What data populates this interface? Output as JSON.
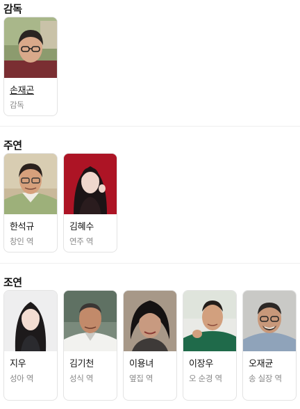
{
  "sections": {
    "director": {
      "title": "감독",
      "people": [
        {
          "name": "손재곤",
          "role": "감독"
        }
      ]
    },
    "lead": {
      "title": "주연",
      "people": [
        {
          "name": "한석규",
          "role": "창인 역"
        },
        {
          "name": "김혜수",
          "role": "연주 역"
        }
      ]
    },
    "supporting": {
      "title": "조연",
      "people": [
        {
          "name": "지우",
          "role": "성아 역"
        },
        {
          "name": "김기천",
          "role": "성식 역"
        },
        {
          "name": "이용녀",
          "role": "옆집 역"
        },
        {
          "name": "이장우",
          "role": "오 순경 역"
        },
        {
          "name": "오재균",
          "role": "송 실장 역"
        }
      ]
    }
  }
}
